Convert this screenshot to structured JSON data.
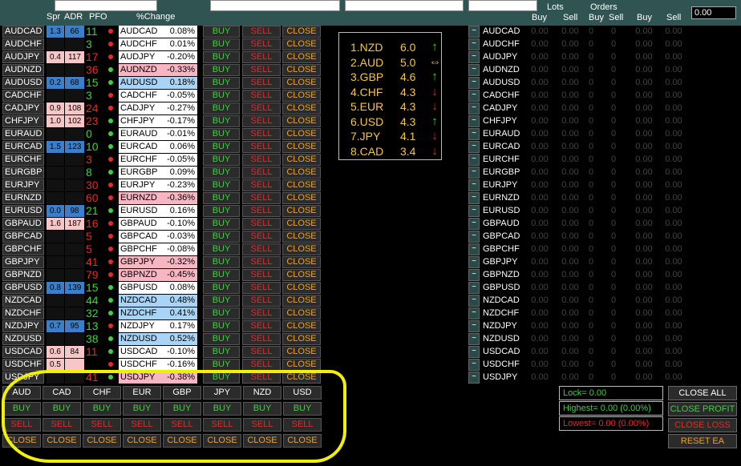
{
  "header": {
    "spr_label": "Spr",
    "adr_label": "ADR",
    "pfo_label": "PFO",
    "pct_label": "%Change",
    "lots_label": "Lots",
    "orders_label": "Orders",
    "buy_label": "Buy",
    "sell_label": "Sell",
    "lot_value": "0.00"
  },
  "colors": {
    "topbar": "#2f5452",
    "buy": "#3bd33b",
    "sell": "#e52a2a",
    "close": "#f0a020",
    "rank_text": "#f5c542",
    "spr_blue": "#3d7fc6",
    "spr_pink": "#f7c7c7",
    "pct_pink": "#f7b6c2",
    "pct_blue": "#a9d4f5",
    "pct_white": "#ffffff",
    "dot_red": "#e52a2a",
    "dot_green": "#3bd33b",
    "highlight": "#f0f000"
  },
  "button_labels": {
    "buy": "BUY",
    "sell": "SELL",
    "close": "CLOSE"
  },
  "pairs": [
    {
      "name": "AUDCAD",
      "spr": "1.3",
      "adr": "66",
      "spr_bg": "#3d7fc6",
      "pfo": "11",
      "pfo_color": "#3bd33b",
      "dot": "#e52a2a",
      "pct": "0.08%",
      "pct_bg": "#ffffff"
    },
    {
      "name": "AUDCHF",
      "spr": "",
      "adr": "",
      "spr_bg": "#111",
      "pfo": "3",
      "pfo_color": "#3bd33b",
      "dot": "#e52a2a",
      "pct": "0.01%",
      "pct_bg": "#ffffff"
    },
    {
      "name": "AUDJPY",
      "spr": "0.4",
      "adr": "117",
      "spr_bg": "#f7c7c7",
      "pfo": "17",
      "pfo_color": "#e52a2a",
      "dot": "#e52a2a",
      "pct": "-0.20%",
      "pct_bg": "#ffffff"
    },
    {
      "name": "AUDNZD",
      "spr": "",
      "adr": "",
      "spr_bg": "#111",
      "pfo": "36",
      "pfo_color": "#e52a2a",
      "dot": "#3bd33b",
      "pct": "-0.33%",
      "pct_bg": "#f7b6c2"
    },
    {
      "name": "AUDUSD",
      "spr": "0.2",
      "adr": "68",
      "spr_bg": "#3d7fc6",
      "pfo": "15",
      "pfo_color": "#3bd33b",
      "dot": "#3bd33b",
      "pct": "0.18%",
      "pct_bg": "#a9d4f5"
    },
    {
      "name": "CADCHF",
      "spr": "",
      "adr": "",
      "spr_bg": "#111",
      "pfo": "3",
      "pfo_color": "#3bd33b",
      "dot": "#e52a2a",
      "pct": "-0.05%",
      "pct_bg": "#ffffff"
    },
    {
      "name": "CADJPY",
      "spr": "0.9",
      "adr": "108",
      "spr_bg": "#f7c7c7",
      "pfo": "24",
      "pfo_color": "#e52a2a",
      "dot": "#e52a2a",
      "pct": "-0.27%",
      "pct_bg": "#ffffff"
    },
    {
      "name": "CHFJPY",
      "spr": "1.0",
      "adr": "102",
      "spr_bg": "#f7c7c7",
      "pfo": "23",
      "pfo_color": "#e52a2a",
      "dot": "#3bd33b",
      "pct": "-0.17%",
      "pct_bg": "#ffffff"
    },
    {
      "name": "EURAUD",
      "spr": "",
      "adr": "",
      "spr_bg": "#111",
      "pfo": "0",
      "pfo_color": "#3bd33b",
      "dot": "#3bd33b",
      "pct": "-0.01%",
      "pct_bg": "#ffffff"
    },
    {
      "name": "EURCAD",
      "spr": "1.5",
      "adr": "123",
      "spr_bg": "#3d7fc6",
      "pfo": "10",
      "pfo_color": "#3bd33b",
      "dot": "#3bd33b",
      "pct": "0.06%",
      "pct_bg": "#ffffff"
    },
    {
      "name": "EURCHF",
      "spr": "",
      "adr": "",
      "spr_bg": "#111",
      "pfo": "3",
      "pfo_color": "#e52a2a",
      "dot": "#e52a2a",
      "pct": "-0.05%",
      "pct_bg": "#ffffff"
    },
    {
      "name": "EURGBP",
      "spr": "",
      "adr": "",
      "spr_bg": "#111",
      "pfo": "8",
      "pfo_color": "#3bd33b",
      "dot": "#3bd33b",
      "pct": "0.09%",
      "pct_bg": "#ffffff"
    },
    {
      "name": "EURJPY",
      "spr": "",
      "adr": "",
      "spr_bg": "#111",
      "pfo": "30",
      "pfo_color": "#e52a2a",
      "dot": "#e52a2a",
      "pct": "-0.23%",
      "pct_bg": "#ffffff"
    },
    {
      "name": "EURNZD",
      "spr": "",
      "adr": "",
      "spr_bg": "#111",
      "pfo": "60",
      "pfo_color": "#e52a2a",
      "dot": "#e52a2a",
      "pct": "-0.36%",
      "pct_bg": "#f7b6c2"
    },
    {
      "name": "EURUSD",
      "spr": "0.0",
      "adr": "98",
      "spr_bg": "#3d7fc6",
      "pfo": "21",
      "pfo_color": "#3bd33b",
      "dot": "#3bd33b",
      "pct": "0.16%",
      "pct_bg": "#ffffff"
    },
    {
      "name": "GBPAUD",
      "spr": "1.6",
      "adr": "187",
      "spr_bg": "#f7c7c7",
      "pfo": "16",
      "pfo_color": "#e52a2a",
      "dot": "#e52a2a",
      "pct": "-0.10%",
      "pct_bg": "#ffffff"
    },
    {
      "name": "GBPCAD",
      "spr": "",
      "adr": "",
      "spr_bg": "#111",
      "pfo": "5",
      "pfo_color": "#e52a2a",
      "dot": "#e52a2a",
      "pct": "-0.03%",
      "pct_bg": "#ffffff"
    },
    {
      "name": "GBPCHF",
      "spr": "",
      "adr": "",
      "spr_bg": "#111",
      "pfo": "5",
      "pfo_color": "#e52a2a",
      "dot": "#e52a2a",
      "pct": "-0.08%",
      "pct_bg": "#ffffff"
    },
    {
      "name": "GBPJPY",
      "spr": "",
      "adr": "",
      "spr_bg": "#111",
      "pfo": "41",
      "pfo_color": "#e52a2a",
      "dot": "#e52a2a",
      "pct": "-0.32%",
      "pct_bg": "#f7b6c2"
    },
    {
      "name": "GBPNZD",
      "spr": "",
      "adr": "",
      "spr_bg": "#111",
      "pfo": "79",
      "pfo_color": "#e52a2a",
      "dot": "#e52a2a",
      "pct": "-0.45%",
      "pct_bg": "#f7b6c2"
    },
    {
      "name": "GBPUSD",
      "spr": "0.8",
      "adr": "139",
      "spr_bg": "#3d7fc6",
      "pfo": "15",
      "pfo_color": "#3bd33b",
      "dot": "#3bd33b",
      "pct": "0.08%",
      "pct_bg": "#ffffff"
    },
    {
      "name": "NZDCAD",
      "spr": "",
      "adr": "",
      "spr_bg": "#111",
      "pfo": "44",
      "pfo_color": "#3bd33b",
      "dot": "#3bd33b",
      "pct": "0.48%",
      "pct_bg": "#a9d4f5"
    },
    {
      "name": "NZDCHF",
      "spr": "",
      "adr": "",
      "spr_bg": "#111",
      "pfo": "32",
      "pfo_color": "#3bd33b",
      "dot": "#3bd33b",
      "pct": "0.41%",
      "pct_bg": "#a9d4f5"
    },
    {
      "name": "NZDJPY",
      "spr": "0.7",
      "adr": "95",
      "spr_bg": "#3d7fc6",
      "pfo": "13",
      "pfo_color": "#3bd33b",
      "dot": "#e52a2a",
      "pct": "0.17%",
      "pct_bg": "#ffffff"
    },
    {
      "name": "NZDUSD",
      "spr": "",
      "adr": "",
      "spr_bg": "#111",
      "pfo": "38",
      "pfo_color": "#3bd33b",
      "dot": "#3bd33b",
      "pct": "0.52%",
      "pct_bg": "#a9d4f5"
    },
    {
      "name": "USDCAD",
      "spr": "0.6",
      "adr": "84",
      "spr_bg": "#f7c7c7",
      "pfo": "11",
      "pfo_color": "#e52a2a",
      "dot": "#3bd33b",
      "pct": "-0.10%",
      "pct_bg": "#ffffff"
    },
    {
      "name": "USDCHF",
      "spr": "0.5",
      "adr": "",
      "spr_bg": "#f7c7c7",
      "pfo": "",
      "pfo_color": "#e52a2a",
      "dot": "#e52a2a",
      "pct": "-0.16%",
      "pct_bg": "#ffffff"
    },
    {
      "name": "USDJPY",
      "spr": "",
      "adr": "",
      "spr_bg": "#111",
      "pfo": "41",
      "pfo_color": "#e52a2a",
      "dot": "#3bd33b",
      "pct": "-0.38%",
      "pct_bg": "#f7b6c2"
    }
  ],
  "right_values": {
    "lots_buy": "0.00",
    "lots_sell": "0.00",
    "orders_buy": "0",
    "orders_sell": "0",
    "buy": "0.00",
    "sell": "0.00"
  },
  "strength": [
    {
      "label": "1.NZD",
      "value": "6.0",
      "dir": "up"
    },
    {
      "label": "2.AUD",
      "value": "5.0",
      "dir": "flat"
    },
    {
      "label": "3.GBP",
      "value": "4.6",
      "dir": "up"
    },
    {
      "label": "4.CHF",
      "value": "4.3",
      "dir": "down"
    },
    {
      "label": "5.EUR",
      "value": "4.3",
      "dir": "down"
    },
    {
      "label": "6.USD",
      "value": "4.3",
      "dir": "up"
    },
    {
      "label": "7.JPY",
      "value": "4.1",
      "dir": "down"
    },
    {
      "label": "8.CAD",
      "value": "3.4",
      "dir": "down"
    }
  ],
  "currencies": [
    "AUD",
    "CAD",
    "CHF",
    "EUR",
    "GBP",
    "JPY",
    "NZD",
    "USD"
  ],
  "stats": {
    "lock": "Lock= 0.00",
    "highest": "Highest= 0.00 (0.00%)",
    "lowest": "Lowest= 0.00 (0.00%)"
  },
  "right_buttons": {
    "close_all": "CLOSE ALL",
    "close_profit": "CLOSE PROFIT",
    "close_loss": "CLOSE LOSS",
    "reset_ea": "RESET EA"
  }
}
